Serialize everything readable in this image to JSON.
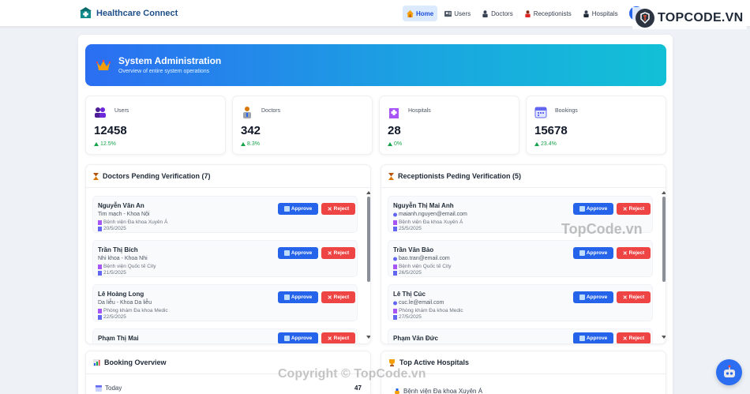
{
  "brand": {
    "name": "Healthcare Connect"
  },
  "nav": [
    {
      "label": "Home",
      "icon": "home-icon",
      "active": true
    },
    {
      "label": "Users",
      "icon": "users-icon"
    },
    {
      "label": "Doctors",
      "icon": "doctor-icon"
    },
    {
      "label": "Receptionists",
      "icon": "receptionist-icon"
    },
    {
      "label": "Hospitals",
      "icon": "hospital-icon"
    }
  ],
  "watermark": {
    "logo_text": "TOPCODE.VN",
    "center_text": "TopCode.vn",
    "copyright": "Copyright © TopCode.vn"
  },
  "banner": {
    "title": "System Administration",
    "subtitle": "Overview of entire system operations"
  },
  "stats": [
    {
      "label": "Users",
      "value": "12458",
      "trend": "12.5%",
      "icon": "users-icon"
    },
    {
      "label": "Doctors",
      "value": "342",
      "trend": "8.3%",
      "icon": "doctor-icon"
    },
    {
      "label": "Hospitals",
      "value": "28",
      "trend": "0%",
      "icon": "hospital-icon"
    },
    {
      "label": "Bookings",
      "value": "15678",
      "trend": "23.4%",
      "icon": "calendar-icon"
    }
  ],
  "doctors_panel": {
    "title": "Doctors Pending Verification (7)",
    "approve_label": "Approve",
    "reject_label": "Reject",
    "items": [
      {
        "name": "Nguyễn Văn An",
        "specialty": "Tim mạch - Khoa Nội",
        "hospital": "Bệnh viện Đa khoa Xuyên Á",
        "date": "20/5/2025"
      },
      {
        "name": "Trần Thị Bích",
        "specialty": "Nhi khoa - Khoa Nhi",
        "hospital": "Bệnh viện Quốc tế City",
        "date": "21/5/2025"
      },
      {
        "name": "Lê Hoàng Long",
        "specialty": "Da liễu - Khoa Da liễu",
        "hospital": "Phòng khám Đa khoa Medic",
        "date": "22/5/2025"
      },
      {
        "name": "Phạm Thị Mai",
        "specialty": "",
        "hospital": "",
        "date": ""
      }
    ]
  },
  "receptionists_panel": {
    "title": "Receptionists Peding Verification (5)",
    "approve_label": "Approve",
    "reject_label": "Reject",
    "items": [
      {
        "name": "Nguyễn Thị Mai Anh",
        "email": "maianh.nguyen@email.com",
        "hospital": "Bệnh viện Đa khoa Xuyên Á",
        "date": "25/5/2025"
      },
      {
        "name": "Trần Văn Bảo",
        "email": "bao.tran@email.com",
        "hospital": "Bệnh viện Quốc tế City",
        "date": "26/5/2025"
      },
      {
        "name": "Lê Thị Cúc",
        "email": "cuc.le@email.com",
        "hospital": "Phòng khám Đa khoa Medic",
        "date": "27/5/2025"
      },
      {
        "name": "Phạm Văn Đức",
        "email": "",
        "hospital": "",
        "date": ""
      }
    ]
  },
  "booking_overview": {
    "title": "Booking Overview",
    "rows": [
      {
        "label": "Today",
        "value": "47"
      }
    ]
  },
  "top_hospitals": {
    "title": "Top Active Hospitals",
    "rows": [
      {
        "name": "Bệnh viện Đa khoa Xuyên Á"
      }
    ]
  },
  "colors": {
    "primary": "#2563eb",
    "danger": "#ef4444",
    "success": "#16a34a",
    "banner_start": "#2b6ef2",
    "banner_end": "#12c0d6"
  }
}
